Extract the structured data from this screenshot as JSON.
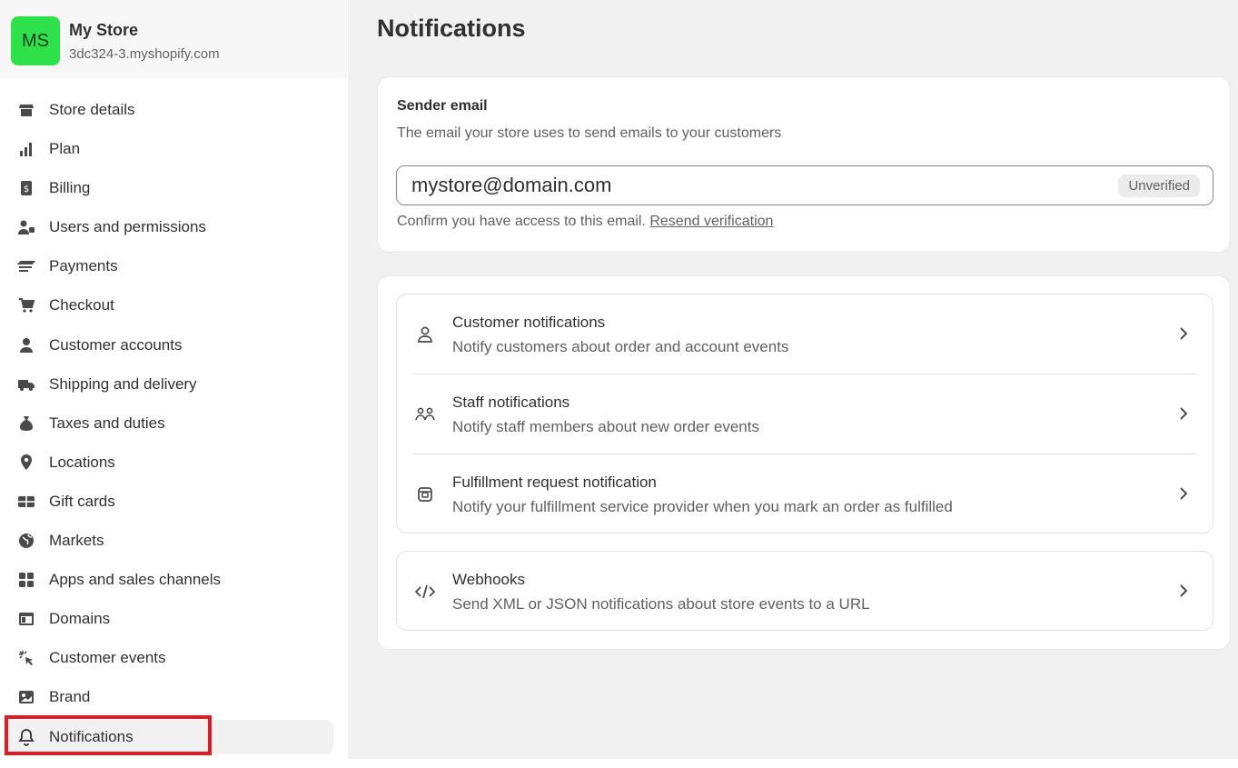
{
  "store": {
    "avatar_initials": "MS",
    "avatar_color": "#2ee04a",
    "name": "My Store",
    "domain": "3dc324-3.myshopify.com"
  },
  "sidebar": {
    "items": [
      {
        "label": "Store details",
        "icon": "store-icon"
      },
      {
        "label": "Plan",
        "icon": "plan-icon"
      },
      {
        "label": "Billing",
        "icon": "billing-icon"
      },
      {
        "label": "Users and permissions",
        "icon": "users-icon"
      },
      {
        "label": "Payments",
        "icon": "payments-icon"
      },
      {
        "label": "Checkout",
        "icon": "cart-icon"
      },
      {
        "label": "Customer accounts",
        "icon": "person-icon"
      },
      {
        "label": "Shipping and delivery",
        "icon": "truck-icon"
      },
      {
        "label": "Taxes and duties",
        "icon": "tax-icon"
      },
      {
        "label": "Locations",
        "icon": "location-pin-icon"
      },
      {
        "label": "Gift cards",
        "icon": "gift-card-icon"
      },
      {
        "label": "Markets",
        "icon": "globe-icon"
      },
      {
        "label": "Apps and sales channels",
        "icon": "apps-icon"
      },
      {
        "label": "Domains",
        "icon": "domains-icon"
      },
      {
        "label": "Customer events",
        "icon": "cursor-click-icon"
      },
      {
        "label": "Brand",
        "icon": "brand-icon"
      },
      {
        "label": "Notifications",
        "icon": "bell-icon"
      }
    ],
    "active_item": "Notifications"
  },
  "main": {
    "title": "Notifications",
    "sender": {
      "title": "Sender email",
      "description": "The email your store uses to send emails to your customers",
      "email_value": "mystore@domain.com",
      "badge": "Unverified",
      "confirm_text": "Confirm you have access to this email. ",
      "resend_link": "Resend verification"
    },
    "notification_rows": [
      {
        "title": "Customer notifications",
        "description": "Notify customers about order and account events",
        "icon": "person-outline-icon"
      },
      {
        "title": "Staff notifications",
        "description": "Notify staff members about new order events",
        "icon": "staff-icon"
      },
      {
        "title": "Fulfillment request notification",
        "description": "Notify your fulfillment service provider when you mark an order as fulfilled",
        "icon": "fulfillment-icon"
      }
    ],
    "webhooks": {
      "title": "Webhooks",
      "description": "Send XML or JSON notifications about store events to a URL",
      "icon": "code-icon"
    }
  },
  "colors": {
    "highlight": "#e01b24",
    "main_bg": "#f1f1f1",
    "card_bg": "#ffffff"
  }
}
